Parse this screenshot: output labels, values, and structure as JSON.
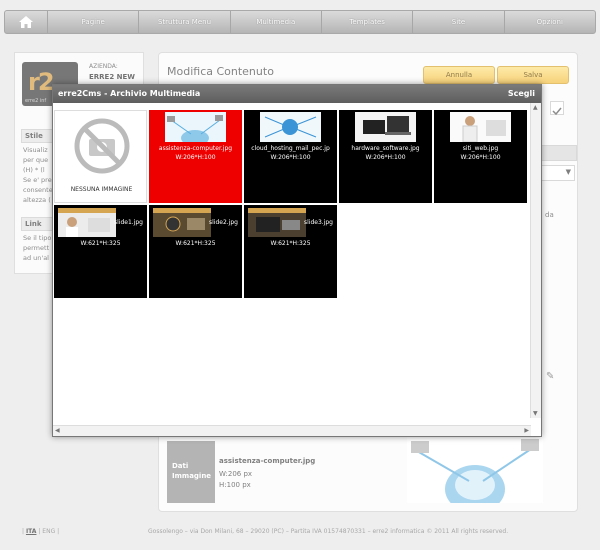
{
  "nav": {
    "items": [
      "Pagine",
      "Struttura Menu",
      "Multimedia",
      "Templates",
      "Site",
      "Opzioni"
    ]
  },
  "sidebar": {
    "azienda_label": "AZIENDA:",
    "azienda_value": "ERRE2 NEW",
    "logo_text": "r2",
    "logo_subtext": "erre2 inf",
    "stile_head": "Stile",
    "stile_text": "Visualiz\nper que\n(H) * (l\nSe e' pre\nconsente\naltezza (",
    "link_head": "Link",
    "link_text": "Se il tipo\npermett\nad un'al"
  },
  "main": {
    "title": "Modifica Contenuto",
    "annulla": "Annulla",
    "salva": "Salva",
    "peek_da": "da",
    "dati_label": "Dati Immagine",
    "dati_name": "assistenza-computer.jpg",
    "dati_w": "W:206 px",
    "dati_h": "H:100 px"
  },
  "modal": {
    "title": "erre2Cms - Archivio Multimedia",
    "choose": "Scegli",
    "no_image_label": "NESSUNA IMMAGINE",
    "tiles": [
      {
        "name": "assistenza-computer.jpg",
        "size": "W:206*H:100",
        "selected": true
      },
      {
        "name": "cloud_hosting_mail_pec.jp",
        "size": "W:206*H:100",
        "selected": false
      },
      {
        "name": "hardware_software.jpg",
        "size": "W:206*H:100",
        "selected": false
      },
      {
        "name": "siti_web.jpg",
        "size": "W:206*H:100",
        "selected": false
      },
      {
        "name": "slide1.jpg",
        "size": "W:621*H:325",
        "selected": false
      },
      {
        "name": "slide2.jpg",
        "size": "W:621*H:325",
        "selected": false
      },
      {
        "name": "slide3.jpg",
        "size": "W:621*H:325",
        "selected": false
      }
    ]
  },
  "footer": {
    "lang_ita": "ITA",
    "lang_eng": "ENG",
    "text": "Gossolengo – via Don Milani, 68 – 29020 (PC) – Partita IVA 01574870331 – erre2 informatica © 2011 All rights reserved."
  },
  "colors": {
    "selected_tile": "#ee0000",
    "button_yellow": "#f4c34f",
    "header_gray": "#6a6a6a"
  }
}
